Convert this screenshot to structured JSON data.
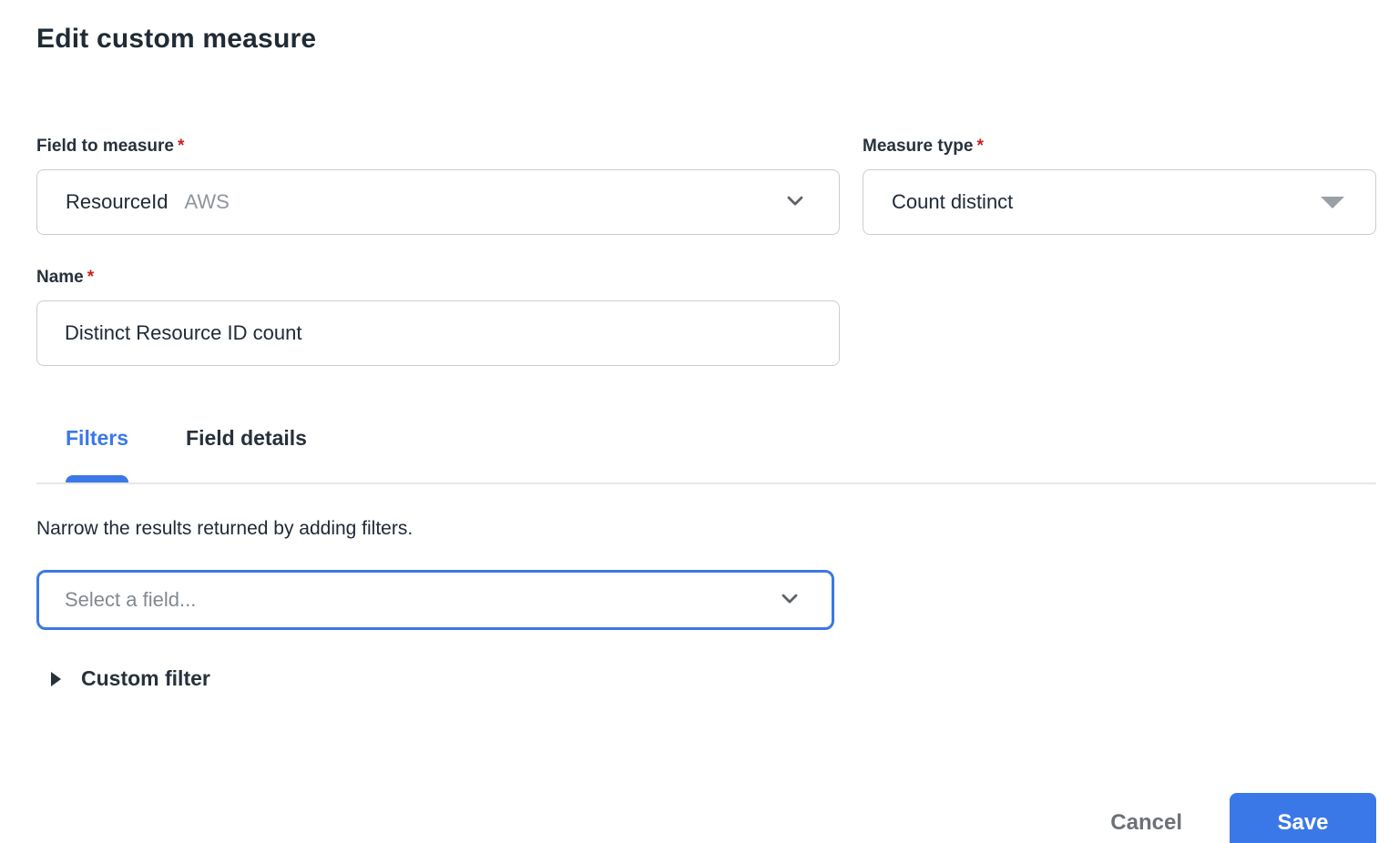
{
  "page": {
    "title": "Edit custom measure"
  },
  "form": {
    "field_to_measure": {
      "label": "Field to measure",
      "required_marker": "*",
      "value": "ResourceId",
      "value_suffix": "AWS"
    },
    "measure_type": {
      "label": "Measure type",
      "required_marker": "*",
      "value": "Count distinct"
    },
    "name": {
      "label": "Name",
      "required_marker": "*",
      "value": "Distinct Resource ID count"
    }
  },
  "tabs": [
    {
      "label": "Filters",
      "active": true
    },
    {
      "label": "Field details",
      "active": false
    }
  ],
  "filters_panel": {
    "description": "Narrow the results returned by adding filters.",
    "field_select_placeholder": "Select a field...",
    "custom_filter_label": "Custom filter"
  },
  "footer": {
    "cancel_label": "Cancel",
    "save_label": "Save"
  },
  "icons": {
    "field_to_measure_dropdown": "chevron-down-icon",
    "measure_type_dropdown": "triangle-down-icon",
    "filter_field_dropdown": "chevron-down-icon",
    "custom_filter_disclosure": "triangle-right-icon"
  },
  "colors": {
    "accent_blue": "#3b78e7",
    "required_red": "#c5221f",
    "text_dark": "#212b36",
    "text_secondary": "#27313c",
    "text_gray": "#8f959c",
    "border_gray": "#c9cdd3",
    "divider_gray": "#e5e7ea",
    "caret_gray": "#9aa0a6"
  }
}
